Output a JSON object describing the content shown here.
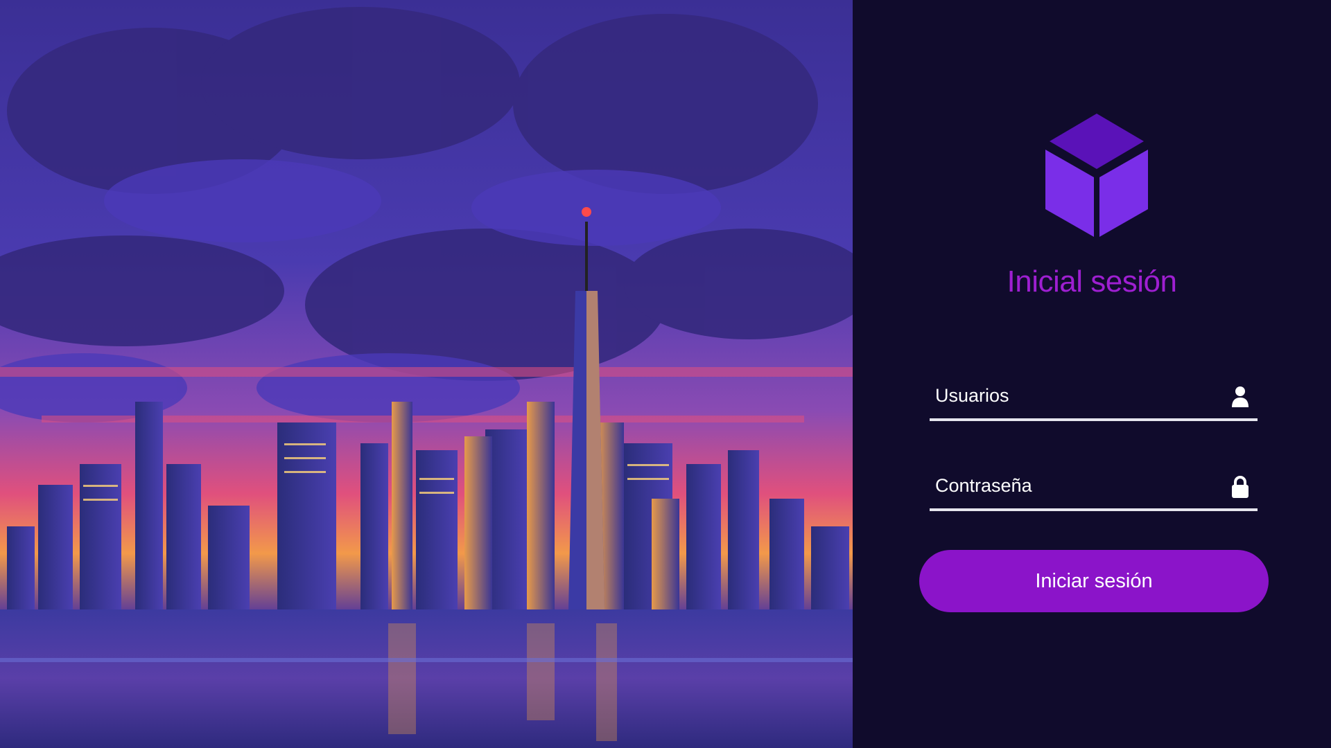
{
  "login": {
    "title": "Inicial sesión",
    "username_placeholder": "Usuarios",
    "password_placeholder": "Contraseña",
    "submit_label": "Iniciar sesión"
  },
  "icons": {
    "logo": "cube-logo-icon",
    "username": "user-icon",
    "password": "lock-icon"
  },
  "colors": {
    "panel_background": "#100b2c",
    "accent": "#8b14c9",
    "title": "#9e1fd1",
    "logo_top": "#5a12b8",
    "logo_sides": "#7a2ee8"
  }
}
